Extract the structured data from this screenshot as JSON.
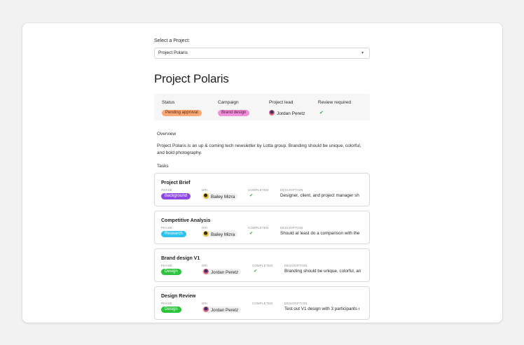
{
  "select_label": "Select a Project:",
  "select_value": "Project Polaris",
  "project_title": "Project Polaris",
  "properties": {
    "status_label": "Status",
    "status_value": "Pending approval",
    "campaign_label": "Campaign",
    "campaign_value": "Brand design",
    "lead_label": "Project lead",
    "lead_value": "Jordan Peretz",
    "review_label": "Review required",
    "review_check": "✔"
  },
  "overview_heading": "Overview",
  "overview_text": "Project Polaris is an up & coming tech newsletter by Lotta group. Branding should be unique, colorful, and bold photography.",
  "tasks_heading": "Tasks",
  "task_labels": {
    "phase": "PHASE",
    "dri": "DRI",
    "completed": "COMPLETED",
    "description": "DESCRIPTION"
  },
  "tasks": [
    {
      "title": "Project Brief",
      "phase": "Background",
      "dri": "Bailey Mizra",
      "completed": "✔",
      "description": "Designer, client, and project manager sh"
    },
    {
      "title": "Competitive Analysis",
      "phase": "Research",
      "dri": "Bailey Mizra",
      "completed": "✔",
      "description": "Should at least do a comparison with the"
    },
    {
      "title": "Brand design V1",
      "phase": "Design",
      "dri": "Jordan Peretz",
      "completed": "✔",
      "description": "Branding should be unique, colorful, an"
    },
    {
      "title": "Design Review",
      "phase": "Design",
      "dri": "Jordan Peretz",
      "completed": "",
      "description": "Test out V1 design with 3 participants ı"
    }
  ],
  "colors": {
    "pending": "#f9a774",
    "brand_design": "#ef8fd9",
    "background_phase": "#8c48e0",
    "research_phase": "#2ec2f0",
    "design_phase": "#2dc23c",
    "check": "#22a83a"
  },
  "icons": [
    "chevron-down-icon",
    "avatar",
    "checkmark-icon"
  ]
}
